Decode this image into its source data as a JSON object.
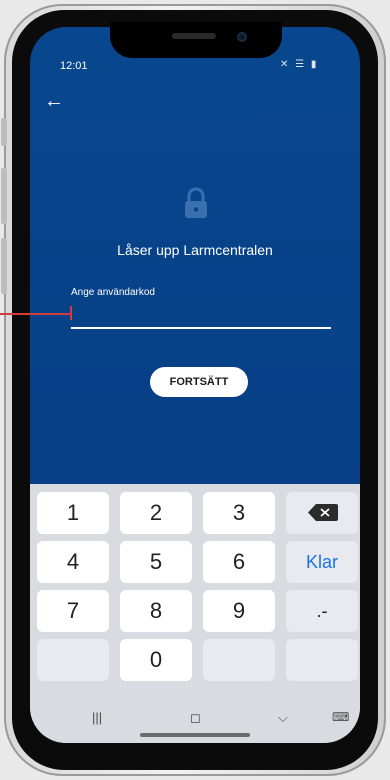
{
  "status": {
    "time": "12:01",
    "icons": "✕ ☰ ▮"
  },
  "header": {
    "back_icon": "←"
  },
  "main": {
    "title": "Låser upp Larmcentralen",
    "input_label": "Ange användarkod",
    "input_value": "",
    "continue_label": "FORTSÄTT"
  },
  "keyboard": {
    "rows": [
      {
        "k1": "1",
        "k2": "2",
        "k3": "3"
      },
      {
        "k1": "4",
        "k2": "5",
        "k3": "6",
        "action": "Klar"
      },
      {
        "k1": "7",
        "k2": "8",
        "k3": "9",
        "symbols": ".-"
      },
      {
        "k2": "0"
      }
    ]
  },
  "navbar": {
    "recents": "|||",
    "home": "◻",
    "back": "⌵",
    "keyboard": "⌨"
  },
  "colors": {
    "screen_top": "#08478f",
    "screen_bottom": "#07367a",
    "accent": "#1a73e8",
    "pointer": "#d23c3c"
  }
}
